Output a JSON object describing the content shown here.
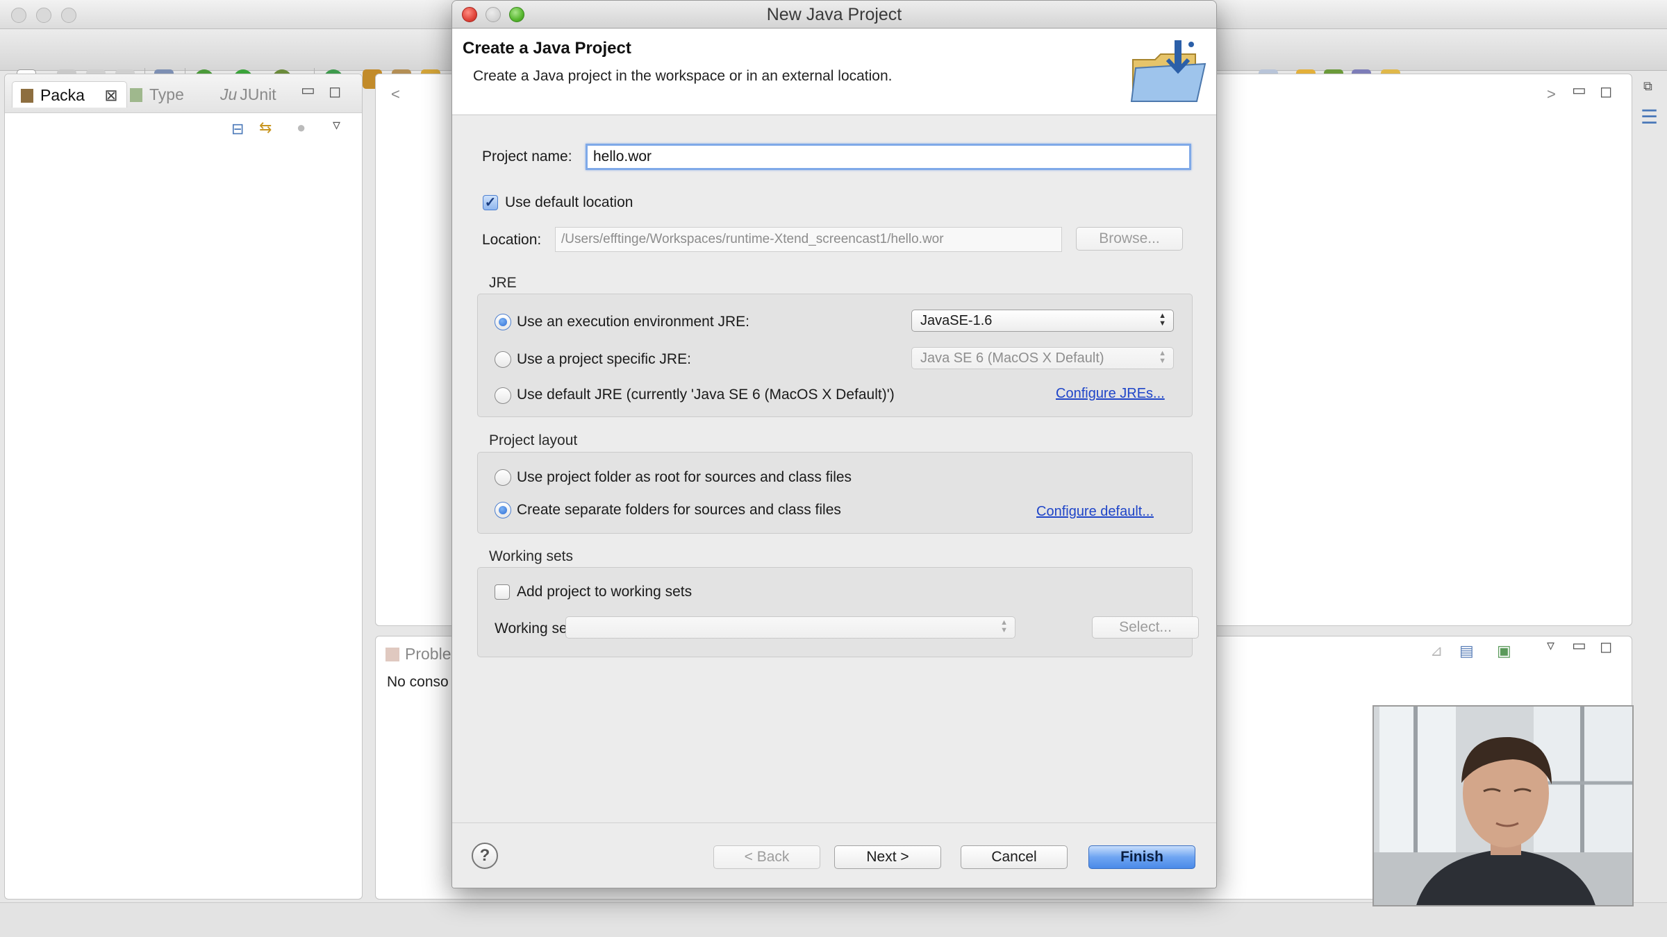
{
  "dialog": {
    "window_title": "New Java Project",
    "header_title": "Create a Java Project",
    "header_description": "Create a Java project in the workspace or in an external location.",
    "project_name_label": "Project name:",
    "project_name_value": "hello.wor",
    "use_default_location_label": "Use default location",
    "use_default_location_checked": true,
    "location_label": "Location:",
    "location_value": "/Users/efftinge/Workspaces/runtime-Xtend_screencast1/hello.wor",
    "browse_label": "Browse...",
    "jre": {
      "title": "JRE",
      "options": [
        {
          "label": "Use an execution environment JRE:",
          "selected": true
        },
        {
          "label": "Use a project specific JRE:",
          "selected": false
        },
        {
          "label": "Use default JRE (currently 'Java SE 6 (MacOS X Default)')",
          "selected": false
        }
      ],
      "execution_env_value": "JavaSE-1.6",
      "project_jre_value": "Java SE 6 (MacOS X Default)",
      "configure_link": "Configure JREs..."
    },
    "layout": {
      "title": "Project layout",
      "options": [
        {
          "label": "Use project folder as root for sources and class files",
          "selected": false
        },
        {
          "label": "Create separate folders for sources and class files",
          "selected": true
        }
      ],
      "configure_link": "Configure default..."
    },
    "working_sets": {
      "title": "Working sets",
      "add_label": "Add project to working sets",
      "add_checked": false,
      "sets_label": "Working sets:",
      "select_label": "Select..."
    },
    "buttons": {
      "help": "?",
      "back": "< Back",
      "next": "Next >",
      "cancel": "Cancel",
      "finish": "Finish"
    }
  },
  "workbench": {
    "tabs": [
      "Packa",
      "Type",
      "JUnit"
    ],
    "editor_nav": "<",
    "editor_nav_right": ">",
    "console_tab": "Proble",
    "console_text": "No conso"
  },
  "colors": {
    "accent": "#2f6fd6",
    "close": "#e0443a",
    "maximize": "#57b72f",
    "link": "#1f45c8"
  }
}
